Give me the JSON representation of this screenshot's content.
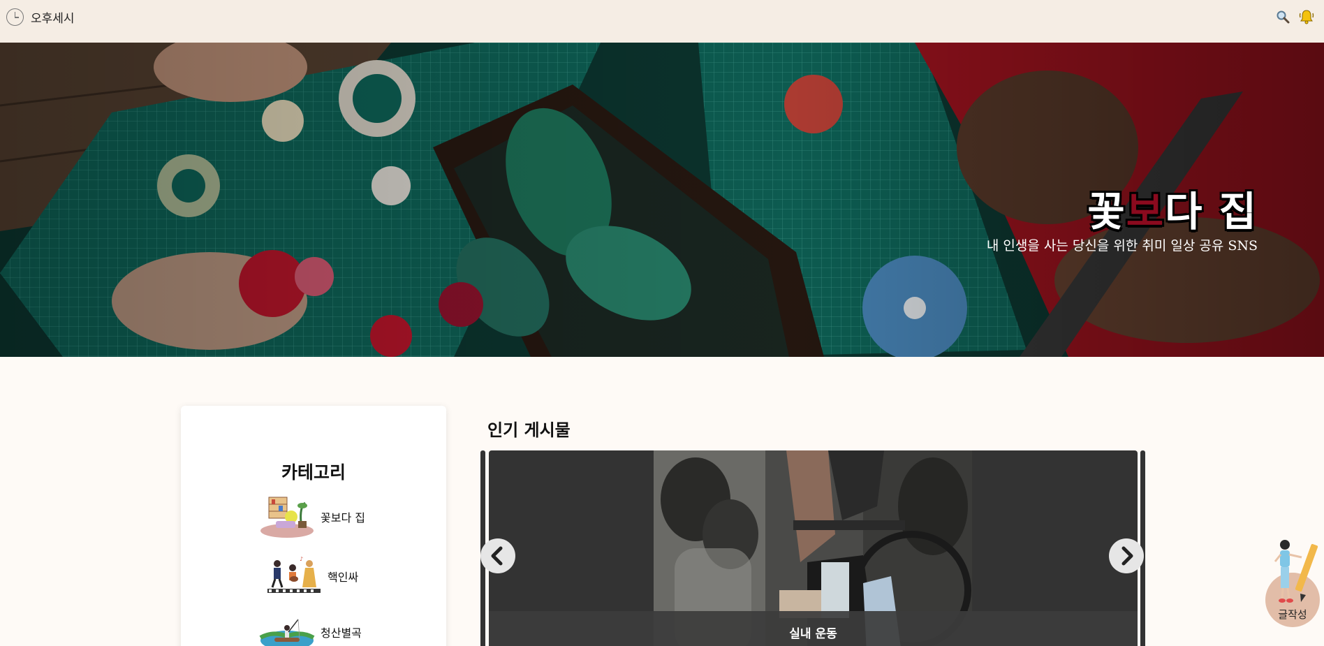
{
  "header": {
    "brand": "오후세시",
    "icons": [
      "clock-icon",
      "search-icon",
      "bell-icon"
    ]
  },
  "hero": {
    "title_part1": "꽃",
    "title_part2": "보",
    "title_part3": "다 집",
    "subtitle": "내 인생을 사는 당신을 위한 취미 일상 공유 SNS",
    "accent": "#8b0a1e"
  },
  "sidebar": {
    "title": "카테고리",
    "items": [
      {
        "label": "꽃보다 집",
        "icon": "home-decor-illustration"
      },
      {
        "label": "핵인싸",
        "icon": "party-people-illustration"
      },
      {
        "label": "청산별곡",
        "icon": "nature-fishing-illustration"
      }
    ]
  },
  "popular": {
    "title": "인기 게시물",
    "slide_caption": "실내 운동",
    "prev_icon": "chevron-left-icon",
    "next_icon": "chevron-right-icon"
  },
  "write_button": {
    "label": "글작성"
  }
}
